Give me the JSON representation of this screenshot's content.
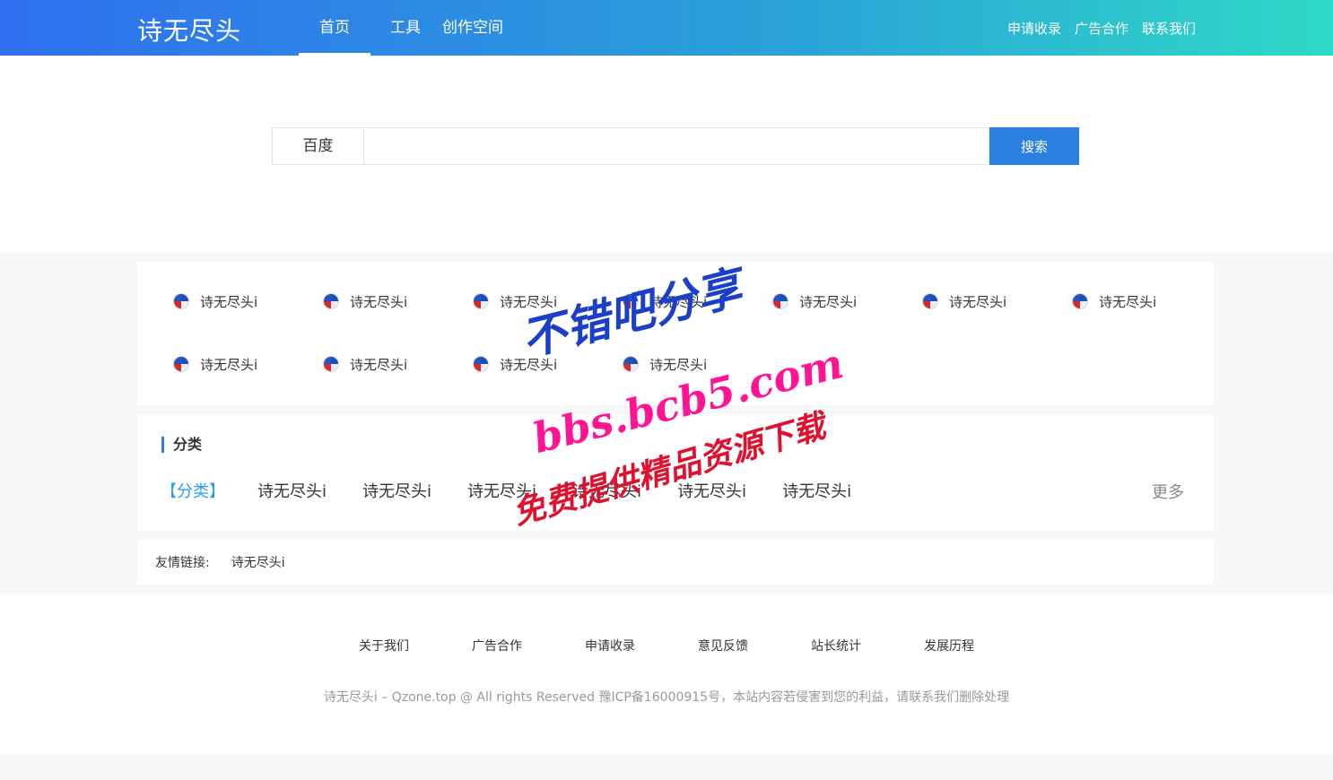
{
  "header": {
    "logo": "诗无尽头",
    "nav": [
      "首页",
      "工具",
      "创作空间"
    ],
    "right_links": [
      "申请收录",
      "广告合作",
      "联系我们"
    ]
  },
  "search": {
    "engine": "百度",
    "value": "",
    "button": "搜索"
  },
  "sites": {
    "items": [
      "诗无尽头i",
      "诗无尽头i",
      "诗无尽头i",
      "诗无尽头i",
      "诗无尽头i",
      "诗无尽头i",
      "诗无尽头i",
      "诗无尽头i",
      "诗无尽头i",
      "诗无尽头i",
      "诗无尽头i"
    ]
  },
  "categories": {
    "title": "分类",
    "label": "【分类】",
    "items": [
      "诗无尽头i",
      "诗无尽头i",
      "诗无尽头i",
      "诗无尽头i",
      "诗无尽头i",
      "诗无尽头i"
    ],
    "more": "更多"
  },
  "friends": {
    "label": "友情链接:",
    "items": [
      "诗无尽头i"
    ]
  },
  "footer": {
    "links": [
      "关于我们",
      "广告合作",
      "申请收录",
      "意见反馈",
      "站长统计",
      "发展历程"
    ],
    "copyright": "诗无尽头i – Qzone.top @ All rights Reserved 豫ICP备16000915号，本站内容若侵害到您的利益，请联系我们删除处理"
  },
  "watermark": {
    "line1": "不错吧分享",
    "line2": "bbs.bcb5.com",
    "line3": "免费提供精品资源下载"
  }
}
